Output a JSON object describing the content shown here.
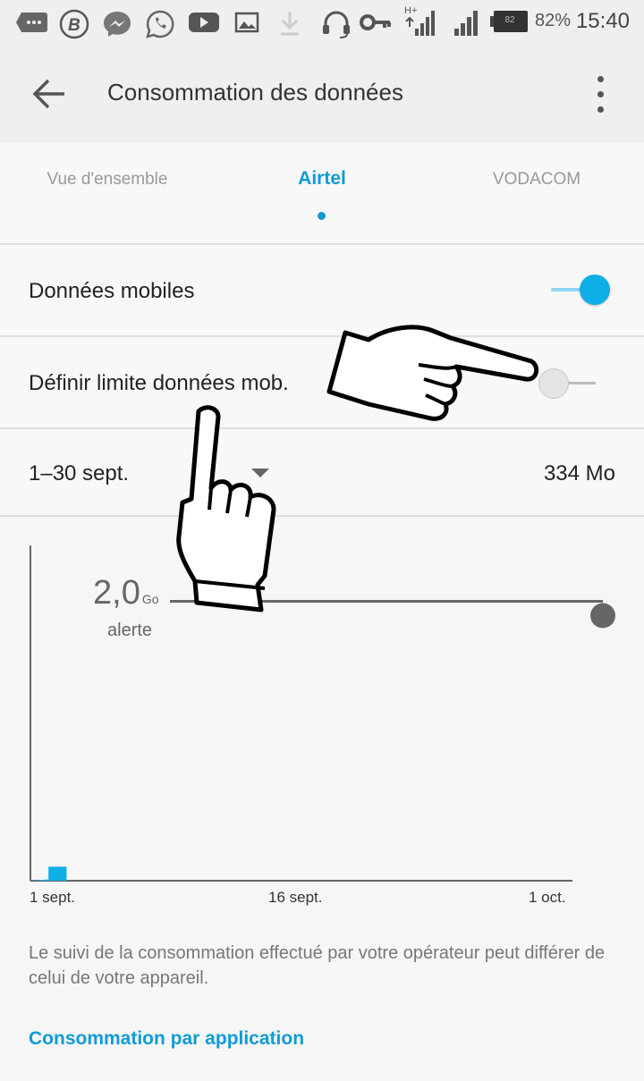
{
  "status_bar": {
    "battery_level": "82",
    "battery_percent": "82%",
    "time": "15:40",
    "network_type": "H+",
    "icons": [
      "message-icon",
      "b-app-icon",
      "messenger-icon",
      "whatsapp-icon",
      "youtube-icon",
      "gallery-icon",
      "download-icon",
      "headset-icon",
      "key-icon",
      "signal-icon",
      "signal-icon",
      "battery-icon"
    ]
  },
  "toolbar": {
    "title": "Consommation des données",
    "back_icon": "arrow-back-icon",
    "overflow_icon": "more-vert-icon"
  },
  "tabs": [
    {
      "label": "Vue d'ensemble",
      "active": false
    },
    {
      "label": "Airtel",
      "active": true
    },
    {
      "label": "VODACOM",
      "active": false
    }
  ],
  "mobile_data": {
    "label": "Données mobiles",
    "enabled": true
  },
  "data_limit": {
    "label": "Définir limite données mob.",
    "enabled": false
  },
  "period": {
    "label": "1–30 sept.",
    "usage": "334 Mo"
  },
  "chart_data": {
    "type": "area",
    "x_start_label": "1 sept.",
    "x_mid_label": "16 sept.",
    "x_end_label": "1 oct.",
    "xlabels": [
      "1 sept.",
      "16 sept.",
      "1 oct."
    ],
    "series": [
      {
        "x": [
          1,
          2,
          2,
          3
        ],
        "y": [
          0.0,
          0.01,
          0.1,
          0.1
        ]
      }
    ],
    "ylim": [
      0,
      2.4
    ],
    "warning": {
      "value": "2,0",
      "unit": "Go",
      "label": "alerte",
      "y": 2.0
    },
    "color": "#0eaee6"
  },
  "note": "Le suivi de la consommation effectué par votre opérateur peut différer de celui de votre appareil.",
  "link": "Consommation par application",
  "colors": {
    "accent": "#0f9bd7",
    "switch_on": "#0eaee6"
  }
}
